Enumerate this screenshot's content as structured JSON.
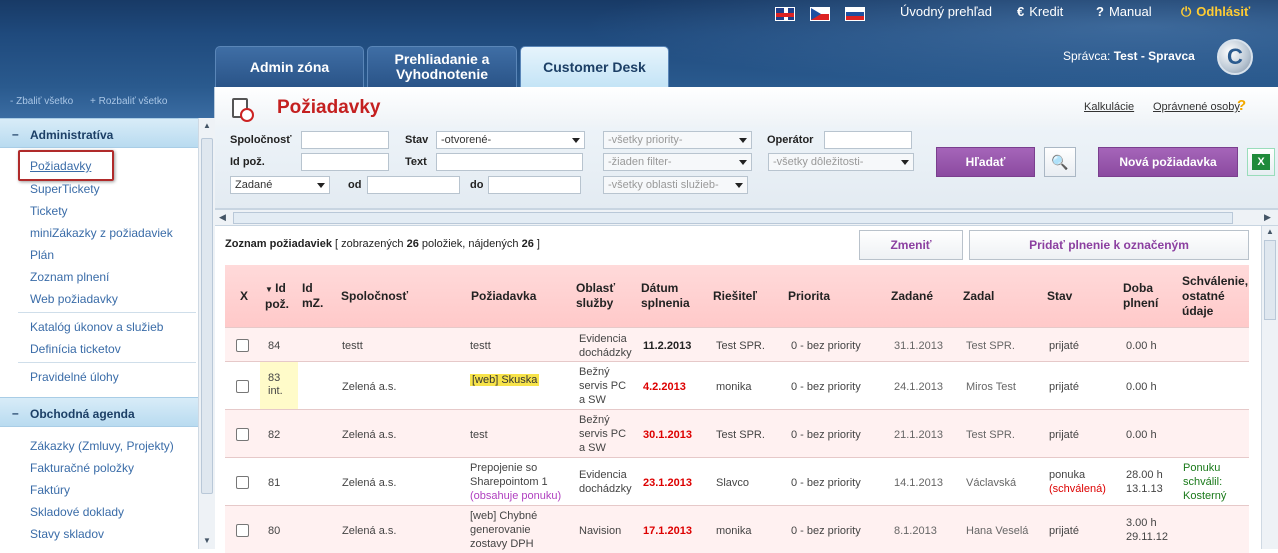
{
  "topbar": {
    "links": [
      {
        "label": "Úvodný prehľad"
      },
      {
        "label": "Kredit",
        "icon": "€"
      },
      {
        "label": "Manual",
        "icon": "?"
      },
      {
        "label": "Odhlásiť",
        "icon": "⏻"
      }
    ],
    "tabs": [
      {
        "label": "Admin zóna"
      },
      {
        "label1": "Prehliadanie a",
        "label2": "Vyhodnotenie"
      },
      {
        "label": "Customer Desk"
      }
    ],
    "admin_prefix": "Správca:",
    "admin_name": "Test - Spravca",
    "logo_letter": "C"
  },
  "sidebar": {
    "collapse_all": "- Zbaliť všetko",
    "expand_all": "+ Rozbaliť všetko",
    "sections": [
      {
        "title": "Administratíva",
        "items": [
          "Požiadavky",
          "SuperTickety",
          "Tickety",
          "miniZákazky z požiadaviek",
          "Plán",
          "Zoznam plnení",
          "Web požiadavky",
          "Katalóg úkonov a služieb",
          "Definícia ticketov",
          "Pravidelné úlohy"
        ]
      },
      {
        "title": "Obchodná agenda",
        "items": [
          "Zákazky (Zmluvy, Projekty)",
          "Fakturačné položky",
          "Faktúry",
          "Skladové doklady",
          "Stavy skladov"
        ]
      }
    ]
  },
  "page": {
    "title": "Požiadavky",
    "links": [
      "Kalkulácie",
      "Oprávnené osoby"
    ],
    "help": "?"
  },
  "filters": {
    "company_label": "Spoločnosť",
    "id_label": "Id pož.",
    "state_label": "Stav",
    "state_value": "-otvorené-",
    "text_label": "Text",
    "date_type_value": "Zadané",
    "from_label": "od",
    "to_label": "do",
    "priority_value": "-všetky priority-",
    "filter_value": "-žiaden filter-",
    "area_value": "-všetky oblasti služieb-",
    "operator_label": "Operátor",
    "importance_value": "-všetky dôležitosti-",
    "search_button": "Hľadať",
    "new_button": "Nová požiadavka"
  },
  "list": {
    "info_prefix": "Zoznam požiadaviek",
    "info_shown_pre": "[ zobrazených",
    "shown": "26",
    "info_found_pre": "položiek, nájdených",
    "found": "26",
    "info_suffix": "]",
    "change_button": "Zmeniť",
    "add_button": "Pridať plnenie k označeným"
  },
  "table": {
    "headers": [
      "X",
      "Id pož.",
      "Id mZ.",
      "Spoločnosť",
      "Požiadavka",
      "Oblasť služby",
      "Dátum splnenia",
      "Riešiteľ",
      "Priorita",
      "Zadané",
      "Zadal",
      "Stav",
      "Doba plnení",
      "Schválenie, ostatné údaje"
    ],
    "rows": [
      {
        "id": "84",
        "company": "testt",
        "request": "testt",
        "area": "Evidencia dochádzky",
        "due": "11.2.2013",
        "solver": "Test SPR.",
        "priority": "0 - bez priority",
        "entered": "31.1.2013",
        "by": "Test SPR.",
        "state": "prijaté",
        "duration": "0.00 h"
      },
      {
        "id": "83",
        "id2": "int.",
        "company": "Zelená a.s.",
        "request": "[web] Skuska",
        "area": "Bežný servis PC a SW",
        "due": "4.2.2013",
        "solver": "monika",
        "priority": "0 - bez priority",
        "entered": "24.1.2013",
        "by": "Miros Test",
        "state": "prijaté",
        "duration": "0.00 h"
      },
      {
        "id": "82",
        "company": "Zelená a.s.",
        "request": "test",
        "area": "Bežný servis PC a SW",
        "due": "30.1.2013",
        "solver": "Test SPR.",
        "priority": "0 - bez priority",
        "entered": "21.1.2013",
        "by": "Test SPR.",
        "state": "prijaté",
        "duration": "0.00 h"
      },
      {
        "id": "81",
        "company": "Zelená a.s.",
        "request": "Prepojenie so Sharepointom 1",
        "request_note": "(obsahuje ponuku)",
        "area": "Evidencia dochádzky",
        "due": "23.1.2013",
        "solver": "Slavco",
        "priority": "0 - bez priority",
        "entered": "14.1.2013",
        "by": "Václavská",
        "state": "ponuka",
        "state_note": "(schválená)",
        "duration": "28.00 h",
        "duration2": "13.1.13",
        "approval": "Ponuku schválil: Kosterný"
      },
      {
        "id": "80",
        "company": "Zelená a.s.",
        "request": "[web] Chybné generovanie zostavy DPH",
        "area": "Navision",
        "due": "17.1.2013",
        "solver": "monika",
        "priority": "0 - bez priority",
        "entered": "8.1.2013",
        "by": "Hana Veselá",
        "state": "prijaté",
        "duration": "3.00 h",
        "duration2": "29.11.12"
      }
    ]
  }
}
